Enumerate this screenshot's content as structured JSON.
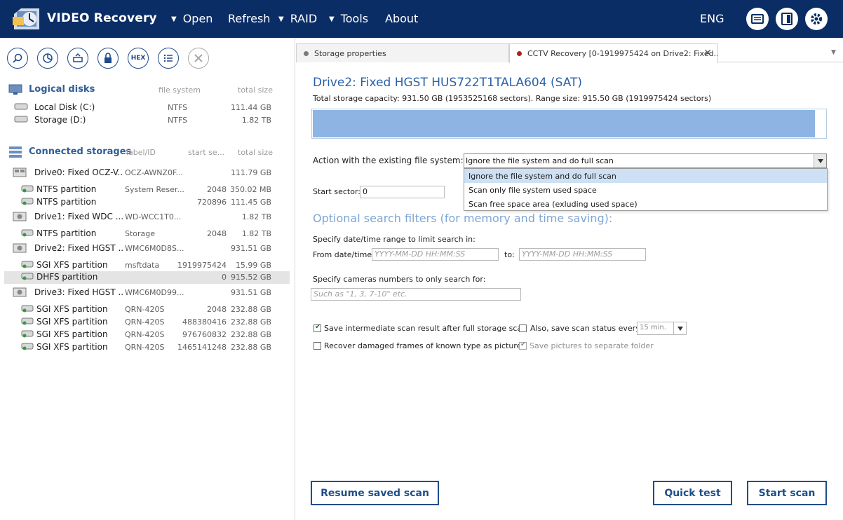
{
  "app": {
    "title": "VIDEO Recovery",
    "menu": [
      {
        "label": "Open",
        "has_dropdown": true
      },
      {
        "label": "Refresh",
        "has_dropdown": false
      },
      {
        "label": "RAID",
        "has_dropdown": true
      },
      {
        "label": "Tools",
        "has_dropdown": true
      },
      {
        "label": "About",
        "has_dropdown": false
      }
    ],
    "language": "ENG",
    "right_icons": [
      "log-icon",
      "panel-toggle-icon",
      "settings-icon"
    ],
    "colors": {
      "topbar": "#0b2d66",
      "accent": "#2a62a9",
      "range_fill": "#8db4e2",
      "button_border": "#1f4e8a"
    }
  },
  "toolbar": {
    "icons": [
      "search-icon",
      "chart-icon",
      "open-drive-icon",
      "lock-icon",
      "hex-icon",
      "list-icon",
      "close-icon"
    ],
    "hex_label": "HEX"
  },
  "logical_disks": {
    "title": "Logical disks",
    "columns": {
      "fs": "file system",
      "size": "total size"
    },
    "items": [
      {
        "name": "Local Disk (C:)",
        "fs": "NTFS",
        "size": "111.44 GB"
      },
      {
        "name": "Storage (D:)",
        "fs": "NTFS",
        "size": "1.82 TB"
      }
    ]
  },
  "connected_storages": {
    "title": "Connected storages",
    "columns": {
      "label": "label/ID",
      "start": "start se...",
      "size": "total size"
    },
    "drive0": {
      "name": "Drive0: Fixed OCZ-V...",
      "label": "OCZ-AWNZ0F...",
      "size": "111.79 GB"
    },
    "drive0_parts": [
      {
        "name": "NTFS partition",
        "label": "System Reser...",
        "start": "2048",
        "size": "350.02 MB"
      },
      {
        "name": "NTFS partition",
        "label": "",
        "start": "720896",
        "size": "111.45 GB"
      }
    ],
    "drive1": {
      "name": "Drive1: Fixed WDC ...",
      "label": "WD-WCC1T0...",
      "size": "1.82 TB"
    },
    "drive1_parts": [
      {
        "name": "NTFS partition",
        "label": "Storage",
        "start": "2048",
        "size": "1.82 TB"
      }
    ],
    "drive2": {
      "name": "Drive2: Fixed HGST ...",
      "label": "WMC6M0D8S...",
      "size": "931.51 GB"
    },
    "drive2_parts": [
      {
        "name": "SGI XFS partition",
        "label": "msftdata",
        "start": "1919975424",
        "size": "15.99 GB"
      },
      {
        "name": "DHFS partition",
        "label": "",
        "start": "0",
        "size": "915.52 GB"
      }
    ],
    "drive3": {
      "name": "Drive3: Fixed HGST ...",
      "label": "WMC6M0D99...",
      "size": "931.51 GB"
    },
    "drive3_parts": [
      {
        "name": "SGI XFS partition",
        "label": "QRN-420S",
        "start": "2048",
        "size": "232.88 GB"
      },
      {
        "name": "SGI XFS partition",
        "label": "QRN-420S",
        "start": "488380416",
        "size": "232.88 GB"
      },
      {
        "name": "SGI XFS partition",
        "label": "QRN-420S",
        "start": "976760832",
        "size": "232.88 GB"
      },
      {
        "name": "SGI XFS partition",
        "label": "QRN-420S",
        "start": "1465141248",
        "size": "232.88 GB"
      }
    ]
  },
  "tabs": [
    {
      "label": "Storage properties",
      "dot_color": "#7a7a7a"
    },
    {
      "label": "CCTV Recovery [0-1919975424 on Drive2: Fixed...",
      "dot_color": "#b02020"
    }
  ],
  "main": {
    "drive_title": "Drive2: Fixed HGST HUS722T1TALA604 (SAT)",
    "capacity_info": "Total storage capacity: 931.50 GB (1953525168 sectors). Range size: 915.50 GB (1919975424 sectors)",
    "action_label": "Action with the existing file system:",
    "action_selected": "Ignore the file system and do full scan",
    "action_options": [
      "Ignore the file system and do full scan",
      "Scan only file system used space",
      "Scan free space area (exluding used space)"
    ],
    "start_sector_label": "Start sector:",
    "start_sector_value": "0",
    "filters_title": "Optional search filters (for memory and time saving):",
    "date_range_label": "Specify date/time range to limit search in:",
    "from_label": "From date/time:",
    "from_placeholder": "YYYY-MM-DD HH:MM:SS",
    "to_label": "to:",
    "to_placeholder": "YYYY-MM-DD HH:MM:SS",
    "cameras_label": "Specify cameras numbers to only search for:",
    "cameras_placeholder": "Such as \"1, 3, 7-10\" etc.",
    "save_intermediate_label": "Save intermediate scan result after full storage scan",
    "save_intermediate_checked": true,
    "save_status_label": "Also, save scan status every",
    "save_status_checked": false,
    "interval_value": "15 min.",
    "recover_frames_label": "Recover damaged frames of known type as pictures",
    "recover_frames_checked": false,
    "save_pictures_label": "Save pictures to separate folder",
    "save_pictures_checked": true,
    "range_fill_fraction": 0.98
  },
  "buttons": {
    "resume": "Resume saved scan",
    "quick_test": "Quick test",
    "start_scan": "Start scan"
  }
}
